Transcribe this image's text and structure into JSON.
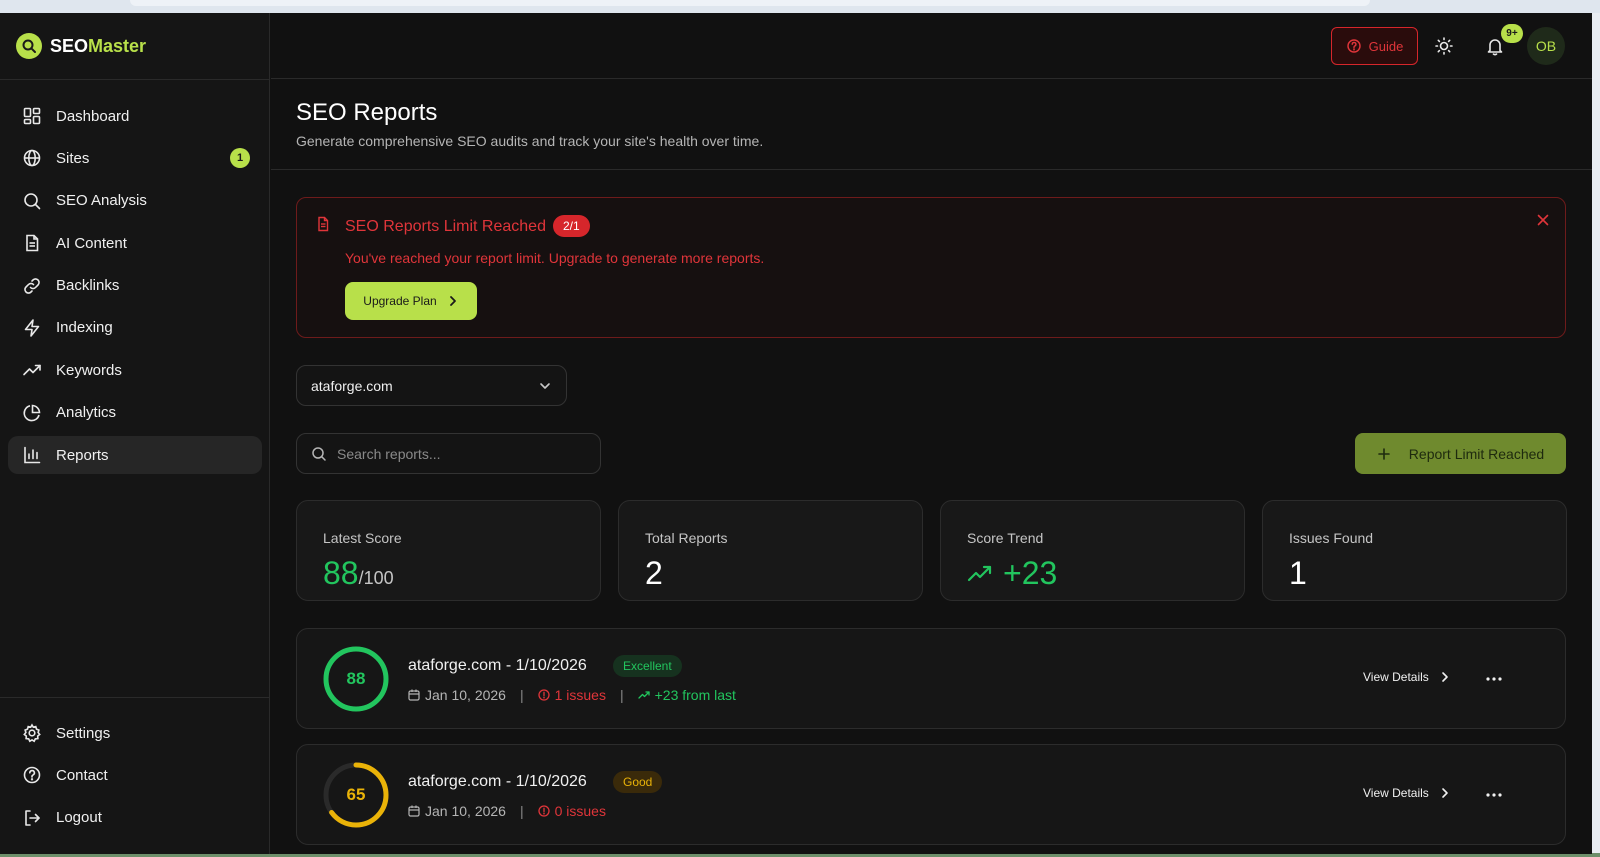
{
  "app": {
    "logo_part1": "SEO",
    "logo_part2": "Master",
    "accent_color": "#b8e04a",
    "danger_color": "#d6262b",
    "success_color": "#22c55e",
    "warning_color": "#eab308"
  },
  "sidebar": {
    "items": [
      {
        "label": "Dashboard",
        "icon": "dashboard-icon"
      },
      {
        "label": "Sites",
        "icon": "globe-icon",
        "badge": "1"
      },
      {
        "label": "SEO Analysis",
        "icon": "search-icon"
      },
      {
        "label": "AI Content",
        "icon": "document-icon"
      },
      {
        "label": "Backlinks",
        "icon": "link-icon"
      },
      {
        "label": "Indexing",
        "icon": "lightning-icon"
      },
      {
        "label": "Keywords",
        "icon": "trend-icon"
      },
      {
        "label": "Analytics",
        "icon": "pie-chart-icon"
      },
      {
        "label": "Reports",
        "icon": "bar-chart-icon",
        "active": true
      }
    ],
    "bottom_items": [
      {
        "label": "Settings",
        "icon": "gear-icon"
      },
      {
        "label": "Contact",
        "icon": "help-icon"
      },
      {
        "label": "Logout",
        "icon": "logout-icon"
      }
    ]
  },
  "header": {
    "guide_label": "Guide",
    "notification_badge": "9+",
    "avatar_initials": "OB"
  },
  "page": {
    "title": "SEO Reports",
    "subtitle": "Generate comprehensive SEO audits and track your site's health over time."
  },
  "alert": {
    "title": "SEO Reports Limit Reached",
    "badge": "2/1",
    "message": "You've reached your report limit. Upgrade to generate more reports.",
    "button_label": "Upgrade Plan"
  },
  "site_select": {
    "value": "ataforge.com"
  },
  "search": {
    "placeholder": "Search reports..."
  },
  "limit_button": {
    "label": "Report Limit Reached"
  },
  "stats": [
    {
      "label": "Latest Score",
      "value": "88",
      "suffix": "/100"
    },
    {
      "label": "Total Reports",
      "value": "2"
    },
    {
      "label": "Score Trend",
      "value": "+23"
    },
    {
      "label": "Issues Found",
      "value": "1"
    }
  ],
  "reports": [
    {
      "score": 88,
      "score_fraction": 1.0,
      "title": "ataforge.com - 1/10/2026",
      "badge": "Excellent",
      "date": "Jan 10, 2026",
      "issues": "1 issues",
      "trend": "+23 from last",
      "view_label": "View Details"
    },
    {
      "score": 65,
      "score_fraction": 0.65,
      "title": "ataforge.com - 1/10/2026",
      "badge": "Good",
      "date": "Jan 10, 2026",
      "issues": "0 issues",
      "view_label": "View Details"
    }
  ]
}
